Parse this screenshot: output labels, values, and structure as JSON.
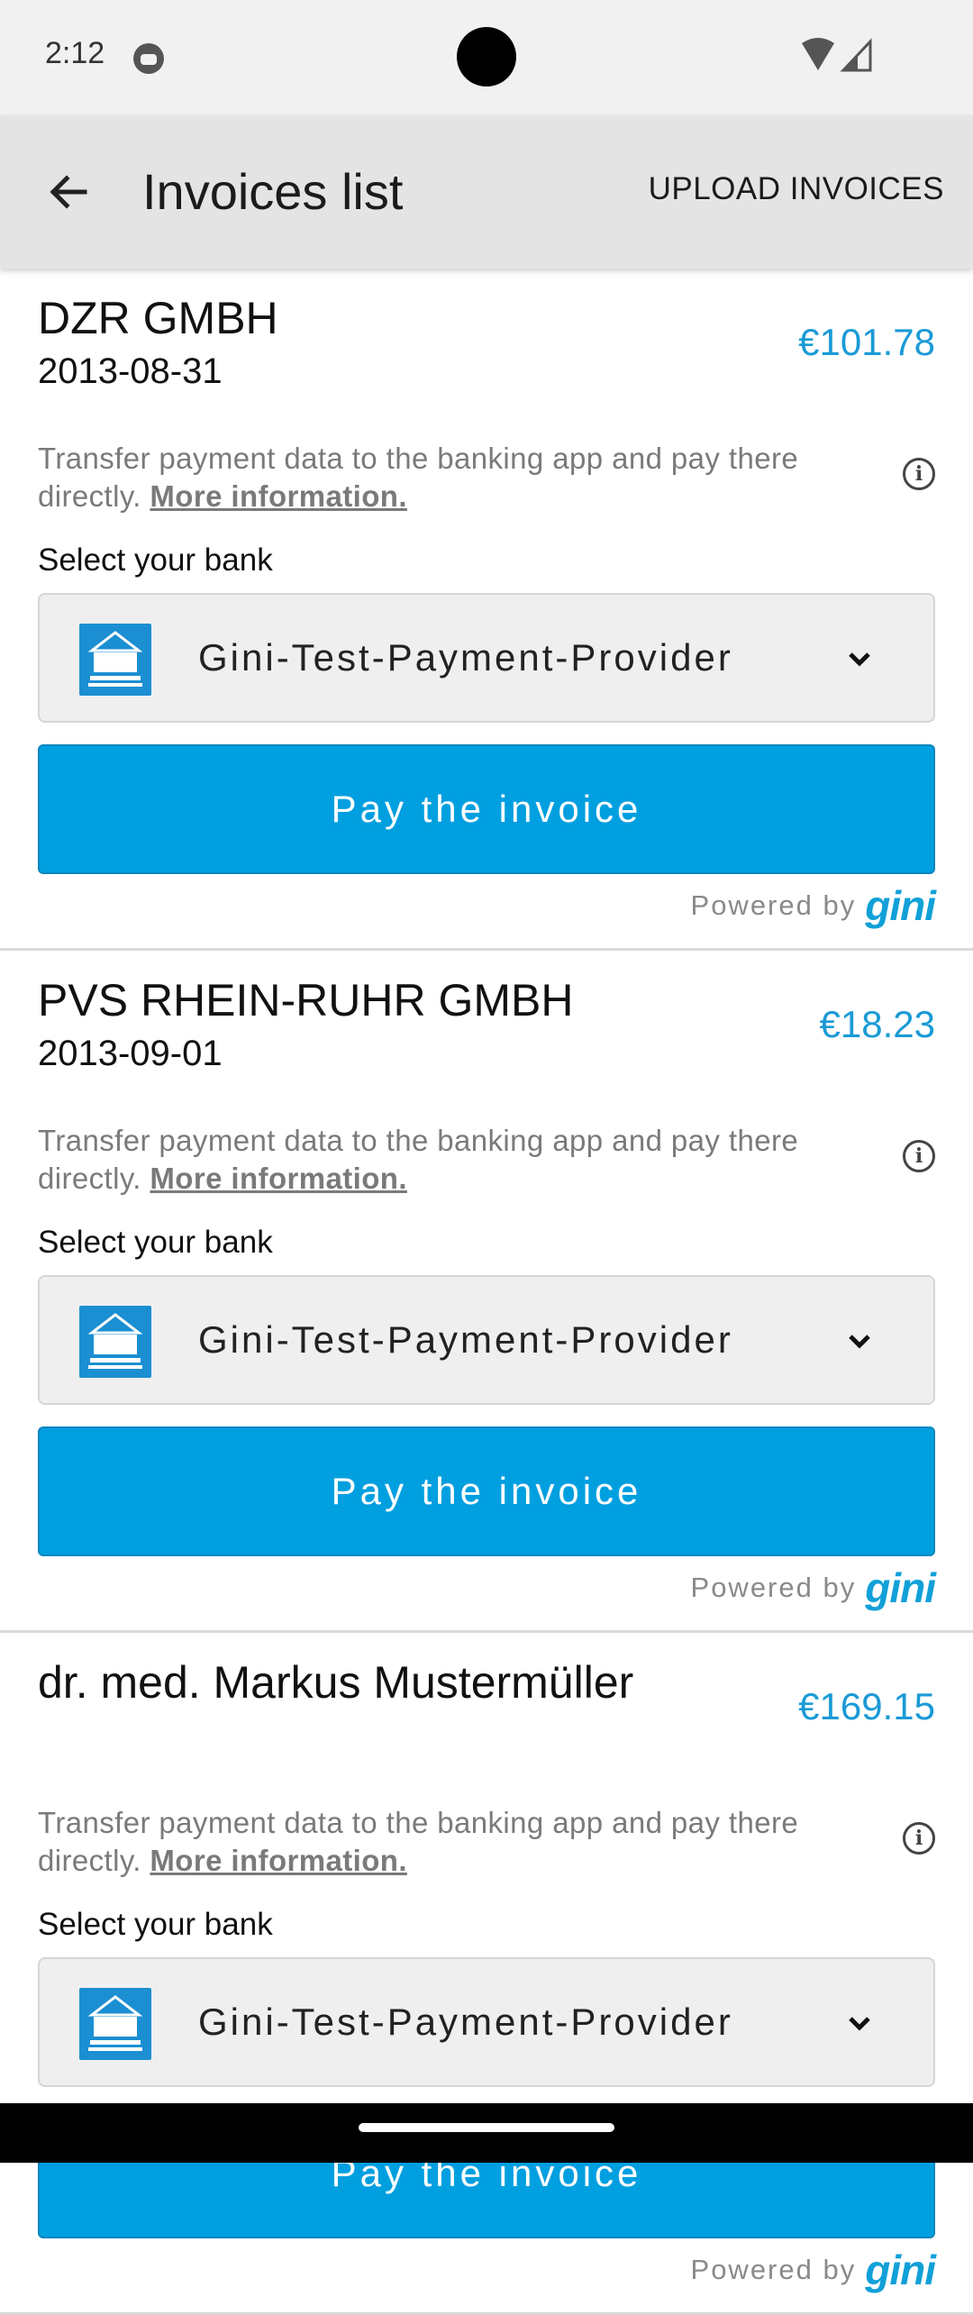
{
  "status_bar": {
    "time": "2:12"
  },
  "app_bar": {
    "title": "Invoices list",
    "upload_label": "UPLOAD INVOICES"
  },
  "invoices": [
    {
      "name": "DZR GMBH",
      "date": "2013-08-31",
      "amount": "€101.78",
      "info_text": "Transfer payment data to the banking app and pay there directly. ",
      "more_info": "More information.",
      "select_label": "Select your bank",
      "bank": "Gini-Test-Payment-Provider",
      "pay_label": "Pay the invoice",
      "powered_by": "Powered by",
      "brand": "gini"
    },
    {
      "name": "PVS RHEIN-RUHR GMBH",
      "date": "2013-09-01",
      "amount": "€18.23",
      "info_text": "Transfer payment data to the banking app and pay there directly. ",
      "more_info": "More information.",
      "select_label": "Select your bank",
      "bank": "Gini-Test-Payment-Provider",
      "pay_label": "Pay the invoice",
      "powered_by": "Powered by",
      "brand": "gini"
    },
    {
      "name": "dr. med. Markus Mustermüller",
      "date": "",
      "amount": "€169.15",
      "info_text": "Transfer payment data to the banking app and pay there directly. ",
      "more_info": "More information.",
      "select_label": "Select your bank",
      "bank": "Gini-Test-Payment-Provider",
      "pay_label": "Pay the invoice",
      "powered_by": "Powered by",
      "brand": "gini"
    }
  ],
  "colors": {
    "accent": "#009fe0",
    "amount": "#1a9ad6",
    "app_bar": "#e4e4e4"
  },
  "icons": {
    "back": "arrow-back-icon",
    "info": "info-icon",
    "dropdown": "chevron-down-icon",
    "bank_logo": "bank-logo-icon"
  }
}
